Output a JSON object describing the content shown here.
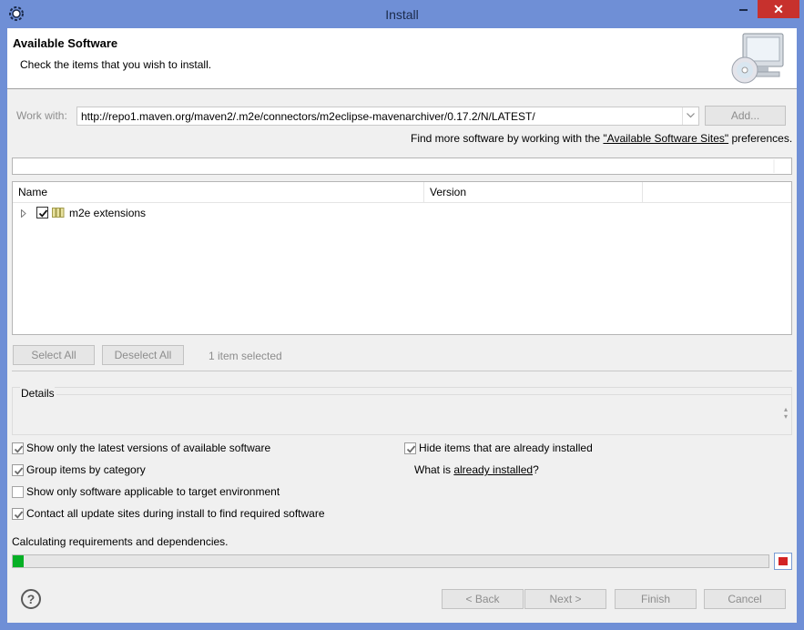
{
  "window": {
    "title": "Install",
    "close_glyph": "✕"
  },
  "header": {
    "title": "Available Software",
    "subtitle": "Check the items that you wish to install.",
    "graphic_icon": "monitor-cd-icon"
  },
  "work_with": {
    "label": "Work with:",
    "value": "http://repo1.maven.org/maven2/.m2e/connectors/m2eclipse-mavenarchiver/0.17.2/N/LATEST/",
    "add_button": "Add..."
  },
  "find_more": {
    "prefix": "Find more software by working with the ",
    "link": "\"Available Software Sites\"",
    "suffix": " preferences."
  },
  "filter": {
    "value": ""
  },
  "table": {
    "columns": [
      "Name",
      "Version",
      ""
    ],
    "rows": [
      {
        "label": "m2e extensions",
        "checked": true
      }
    ]
  },
  "selection": {
    "select_all": "Select All",
    "deselect_all": "Deselect All",
    "count": "1 item selected"
  },
  "details": {
    "label": "Details"
  },
  "options": {
    "latest_versions": "Show only the latest versions of available software",
    "group_by_category": "Group items by category",
    "target_env": "Show only software applicable to target environment",
    "contact_sites": "Contact all update sites during install to find required software",
    "hide_installed": "Hide items that are already installed",
    "what_is_prefix": "What is ",
    "what_is_link": "already installed",
    "what_is_suffix": "?"
  },
  "progress": {
    "status": "Calculating requirements and dependencies.",
    "fraction": 0.015,
    "fill_color": "#06b025"
  },
  "footer": {
    "help": "?",
    "back": "< Back",
    "next": "Next >",
    "finish": "Finish",
    "cancel": "Cancel"
  },
  "colors": {
    "frame": "#6f8fd6",
    "close": "#c7312d",
    "progress": "#06b025",
    "stop": "#d32424"
  }
}
